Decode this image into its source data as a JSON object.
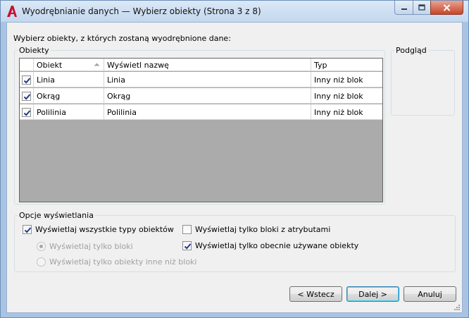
{
  "window": {
    "title": "Wyodrębnianie danych — Wybierz obiekty (Strona 3 z 8)"
  },
  "instruction": "Wybierz obiekty, z których zostaną wyodrębnione dane:",
  "objects_group": {
    "label": "Obiekty",
    "columns": [
      "Obiekt",
      "Wyświetl nazwę",
      "Typ"
    ],
    "sort_column": "Obiekt",
    "rows": [
      {
        "checked": true,
        "object": "Linia",
        "display_name": "Linia",
        "type": "Inny niż blok"
      },
      {
        "checked": true,
        "object": "Okrąg",
        "display_name": "Okrąg",
        "type": "Inny niż blok"
      },
      {
        "checked": true,
        "object": "Polilinia",
        "display_name": "Polilinia",
        "type": "Inny niż blok"
      }
    ]
  },
  "preview_group": {
    "label": "Podgląd"
  },
  "display_options": {
    "label": "Opcje wyświetlania",
    "show_all_types": {
      "label": "Wyświetlaj wszystkie typy obiektów",
      "checked": true
    },
    "blocks_only": {
      "label": "Wyświetlaj tylko bloki",
      "selected": true,
      "enabled": false
    },
    "non_blocks_only": {
      "label": "Wyświetlaj tylko obiekty inne niż bloki",
      "selected": false,
      "enabled": false
    },
    "blocks_with_attributes": {
      "label": "Wyświetlaj tylko bloki z atrybutami",
      "checked": false
    },
    "currently_used": {
      "label": "Wyświetlaj tylko obecnie używane obiekty",
      "checked": true
    }
  },
  "buttons": {
    "back": "< Wstecz",
    "next": "Dalej >",
    "cancel": "Anuluj"
  },
  "colors": {
    "app_icon_red": "#c8102e",
    "grid_empty": "#ababab",
    "default_button_border": "#3c7fb1"
  }
}
